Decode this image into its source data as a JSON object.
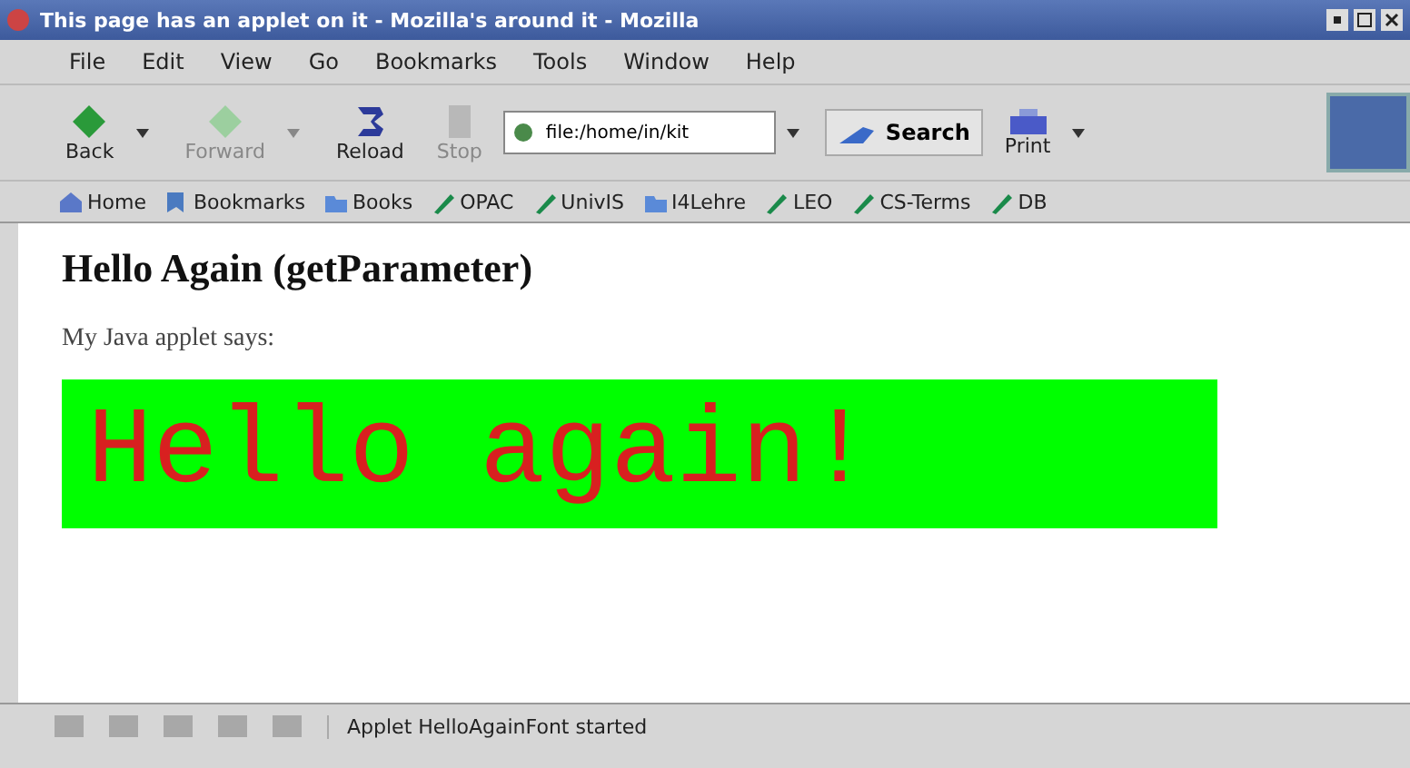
{
  "window": {
    "title": "This page has an applet on it - Mozilla's around it - Mozilla"
  },
  "menu": [
    "File",
    "Edit",
    "View",
    "Go",
    "Bookmarks",
    "Tools",
    "Window",
    "Help"
  ],
  "nav": [
    {
      "label": "Back",
      "kind": "back",
      "disabled": false,
      "dropdown": true
    },
    {
      "label": "Forward",
      "kind": "forward",
      "disabled": true,
      "dropdown": true
    },
    {
      "label": "Reload",
      "kind": "reload",
      "disabled": false,
      "dropdown": false
    },
    {
      "label": "Stop",
      "kind": "stop",
      "disabled": true,
      "dropdown": false
    }
  ],
  "address": {
    "value": "file:/home/in/kit"
  },
  "search_button": "Search",
  "print_button": "Print",
  "bookmarks": [
    {
      "label": "Home",
      "kind": "home"
    },
    {
      "label": "Bookmarks",
      "kind": "bookmarks"
    },
    {
      "label": "Books",
      "kind": "folder"
    },
    {
      "label": "OPAC",
      "kind": "link"
    },
    {
      "label": "UnivIS",
      "kind": "link"
    },
    {
      "label": "I4Lehre",
      "kind": "folder"
    },
    {
      "label": "LEO",
      "kind": "link"
    },
    {
      "label": "CS-Terms",
      "kind": "link"
    },
    {
      "label": "DB",
      "kind": "link"
    }
  ],
  "page": {
    "heading": "Hello Again (getParameter)",
    "text": "My Java applet says:",
    "applet": {
      "message": "Hello again!"
    }
  },
  "status_bar": {
    "text": "Applet HelloAgainFont started"
  }
}
